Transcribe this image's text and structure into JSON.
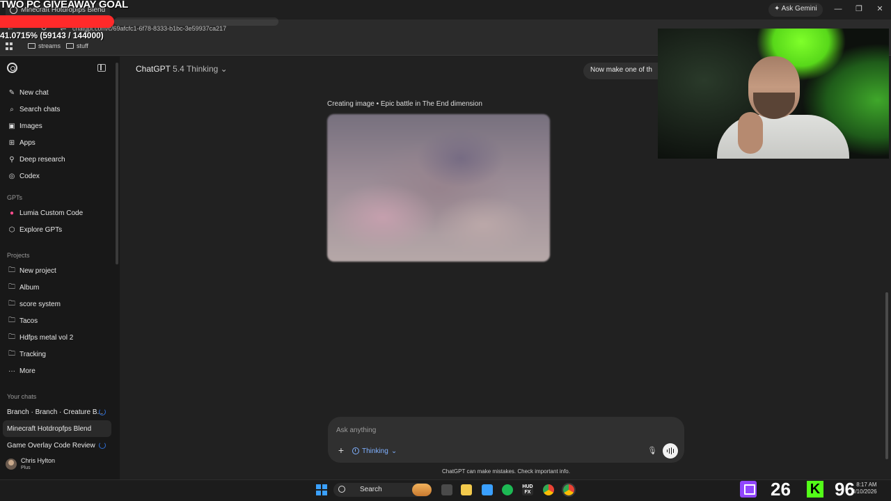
{
  "browser": {
    "tab_title": "Minecraft Hotdropfps Blend",
    "url": "chatgpt.com/c/69afcfc1-6f78-8333-b1bc-3e59937ca217",
    "ask_gemini": "Ask Gemini",
    "bookmarks": [
      "streams",
      "stuff"
    ]
  },
  "stream_overlay": {
    "goal_title": "TWO PC GIVEAWAY GOAL",
    "goal_progress_text": "41.0715% (59143 / 144000)",
    "goal_progress_fraction": 0.410715,
    "goal_color": "#ff2a2a"
  },
  "sidebar": {
    "top_items": [
      {
        "label": "New chat",
        "icon": "new-chat-icon"
      },
      {
        "label": "Search chats",
        "icon": "search-icon"
      },
      {
        "label": "Images",
        "icon": "images-icon"
      },
      {
        "label": "Apps",
        "icon": "apps-icon"
      },
      {
        "label": "Deep research",
        "icon": "deep-research-icon"
      },
      {
        "label": "Codex",
        "icon": "codex-icon"
      }
    ],
    "gpts_heading": "GPTs",
    "gpts": [
      {
        "label": "Lumia Custom Code",
        "icon": "gpt-avatar-icon"
      },
      {
        "label": "Explore GPTs",
        "icon": "explore-icon"
      }
    ],
    "projects_heading": "Projects",
    "projects": [
      {
        "label": "New project",
        "icon": "new-folder-icon"
      },
      {
        "label": "Album",
        "icon": "folder-icon"
      },
      {
        "label": "score system",
        "icon": "folder-icon"
      },
      {
        "label": "Tacos",
        "icon": "folder-icon"
      },
      {
        "label": "Hdfps metal vol 2",
        "icon": "folder-icon"
      },
      {
        "label": "Tracking",
        "icon": "folder-icon"
      },
      {
        "label": "More",
        "icon": "more-icon"
      }
    ],
    "chats_heading": "Your chats",
    "chats": [
      {
        "label": "Branch · Branch · Creature B...",
        "loading": true
      },
      {
        "label": "Minecraft Hotdropfps Blend",
        "loading": false
      },
      {
        "label": "Game Overlay Code Review",
        "loading": true
      }
    ],
    "profile": {
      "name": "Chris Hylton",
      "plan": "Plus"
    }
  },
  "main": {
    "model_name": "ChatGPT",
    "model_version": "5.4 Thinking",
    "user_message": "Now make one of th",
    "image_caption": "Creating image • Epic battle in The End dimension",
    "composer": {
      "placeholder": "Ask anything",
      "mode_label": "Thinking"
    },
    "disclaimer": "ChatGPT can make mistakes. Check important info."
  },
  "taskbar": {
    "search_label": "Search",
    "twitch_count": "26",
    "kick_count": "96",
    "kick_logo": "K",
    "time": "8:17 AM",
    "date": "3/10/2026"
  },
  "colors": {
    "accent_blue": "#7fb0ff",
    "twitch": "#9146ff",
    "kick": "#53fc18"
  }
}
